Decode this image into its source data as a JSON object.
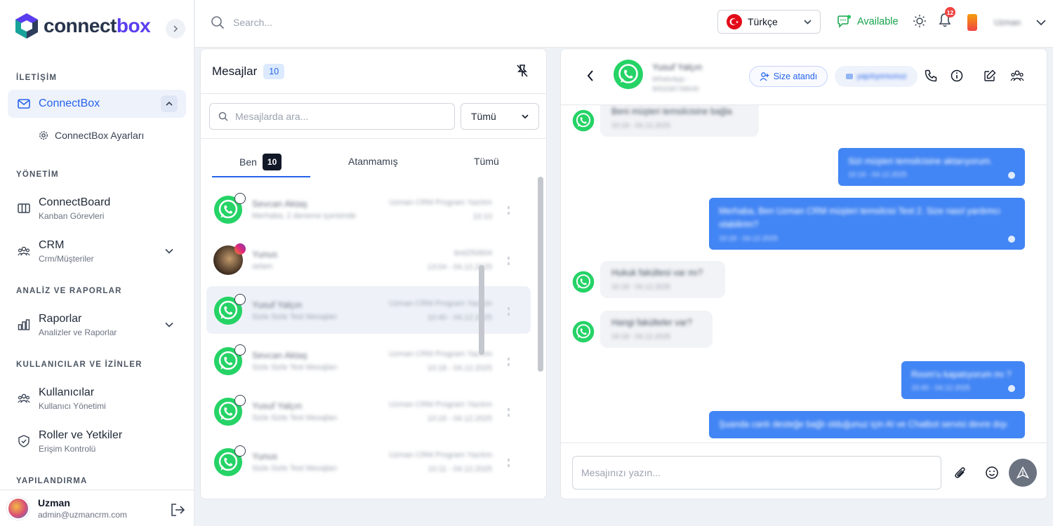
{
  "brand": {
    "name_part1": "connect",
    "name_part2": "box",
    "accent": "#5b3df0"
  },
  "sidebar": {
    "sections": {
      "iletisim": "İLETİŞİM",
      "yonetim": "YÖNETİM",
      "analiz": "ANALİZ VE RAPORLAR",
      "kullanicilar": "KULLANICILAR VE İZİNLER",
      "yapilandirma": "YAPILANDIRMA"
    },
    "items": {
      "connectbox": "ConnectBox",
      "connectbox_settings": "ConnectBox Ayarları",
      "connectboard": "ConnectBoard",
      "connectboard_sub": "Kanban Görevleri",
      "crm": "CRM",
      "crm_sub": "Crm/Müşteriler",
      "raporlar": "Raporlar",
      "raporlar_sub": "Analizler ve Raporlar",
      "kullanicilar": "Kullanıcılar",
      "kullanicilar_sub": "Kullanıcı Yönetimi",
      "roller": "Roller ve Yetkiler",
      "roller_sub": "Erişim Kontrolü"
    },
    "footer": {
      "name": "Uzman",
      "email": "admin@uzmancrm.com"
    }
  },
  "topbar": {
    "search_placeholder": "Search...",
    "language": "Türkçe",
    "status": "Available",
    "status_color": "#16a34a",
    "notification_count": "12",
    "user_name": "Uzman"
  },
  "messages": {
    "title": "Mesajlar",
    "count": "10",
    "search_placeholder": "Mesajlarda ara...",
    "filter_value": "Tümü",
    "tabs": {
      "ben": "Ben",
      "ben_count": "10",
      "atanmamis": "Atanmamış",
      "tumu": "Tümü"
    },
    "conversations": [
      {
        "name": "Sevcan Aktaş",
        "preview": "Merhaba, 2 deneme içerisinde",
        "agent": "Uzman CRM Program Yazılım",
        "time": "10:10",
        "source": "whatsapp"
      },
      {
        "name": "Yunus",
        "preview": "selam",
        "agent": "test250604",
        "time": "13:04 - 04.12.2025",
        "source": "instagram"
      },
      {
        "name": "Yusuf Yalçın",
        "preview": "Sizle Sizle Test Mesajları",
        "agent": "Uzman CRM Program Yazılım",
        "time": "10:40 - 04.12.2025",
        "source": "whatsapp"
      },
      {
        "name": "Sevcan Aktaş",
        "preview": "Sizle Sizle Test Mesajları",
        "agent": "Uzman CRM Program Yazılım",
        "time": "10:18 - 04.12.2025",
        "source": "whatsapp"
      },
      {
        "name": "Yusuf Yalçın",
        "preview": "Sizle Sizle Test Mesajları",
        "agent": "Uzman CRM Program Yazılım",
        "time": "10:16 - 04.12.2025",
        "source": "whatsapp"
      },
      {
        "name": "Yunus",
        "preview": "Sizle Sizle Test Mesajları",
        "agent": "Uzman CRM Program Yazılım",
        "time": "10:11 - 04.12.2025",
        "source": "whatsapp"
      }
    ]
  },
  "chat": {
    "contact_name": "Yusuf Yalçın",
    "contact_channel": "WhatsApp -",
    "contact_phone": "905338739640",
    "assigned_label": "Size atandı",
    "tag_label": "yapılıyorsunuz",
    "compose_placeholder": "Mesajınızı yazın...",
    "messages": [
      {
        "dir": "in",
        "text": "Beni müşteri temsilcisine bağla",
        "time": "10:18 - 04.12.2025"
      },
      {
        "dir": "out",
        "text": "Sizi müşteri temsilcisine aktarıyorum.",
        "time": "10:18 - 04.12.2025"
      },
      {
        "dir": "out",
        "text": "Merhaba, Ben Uzman CRM müşteri temsilcisi Test 2. Size nasıl yardımcı olabilirim?",
        "time": "10:18 - 04.12.2025"
      },
      {
        "dir": "in",
        "text": "Hukuk fakültesi var mı?",
        "time": "10:18 - 04.12.2025"
      },
      {
        "dir": "in",
        "text": "Hangi fakülteler var?",
        "time": "10:18 - 04.12.2025"
      },
      {
        "dir": "out",
        "text": "Room'u kapatıyorum mı ?",
        "time": "10:40 - 04.12.2025"
      },
      {
        "dir": "out",
        "text": "Şuanda canlı desteğe bağlı olduğunuz için AI ve Chatbot servisi devre dışı",
        "time": ""
      }
    ]
  }
}
